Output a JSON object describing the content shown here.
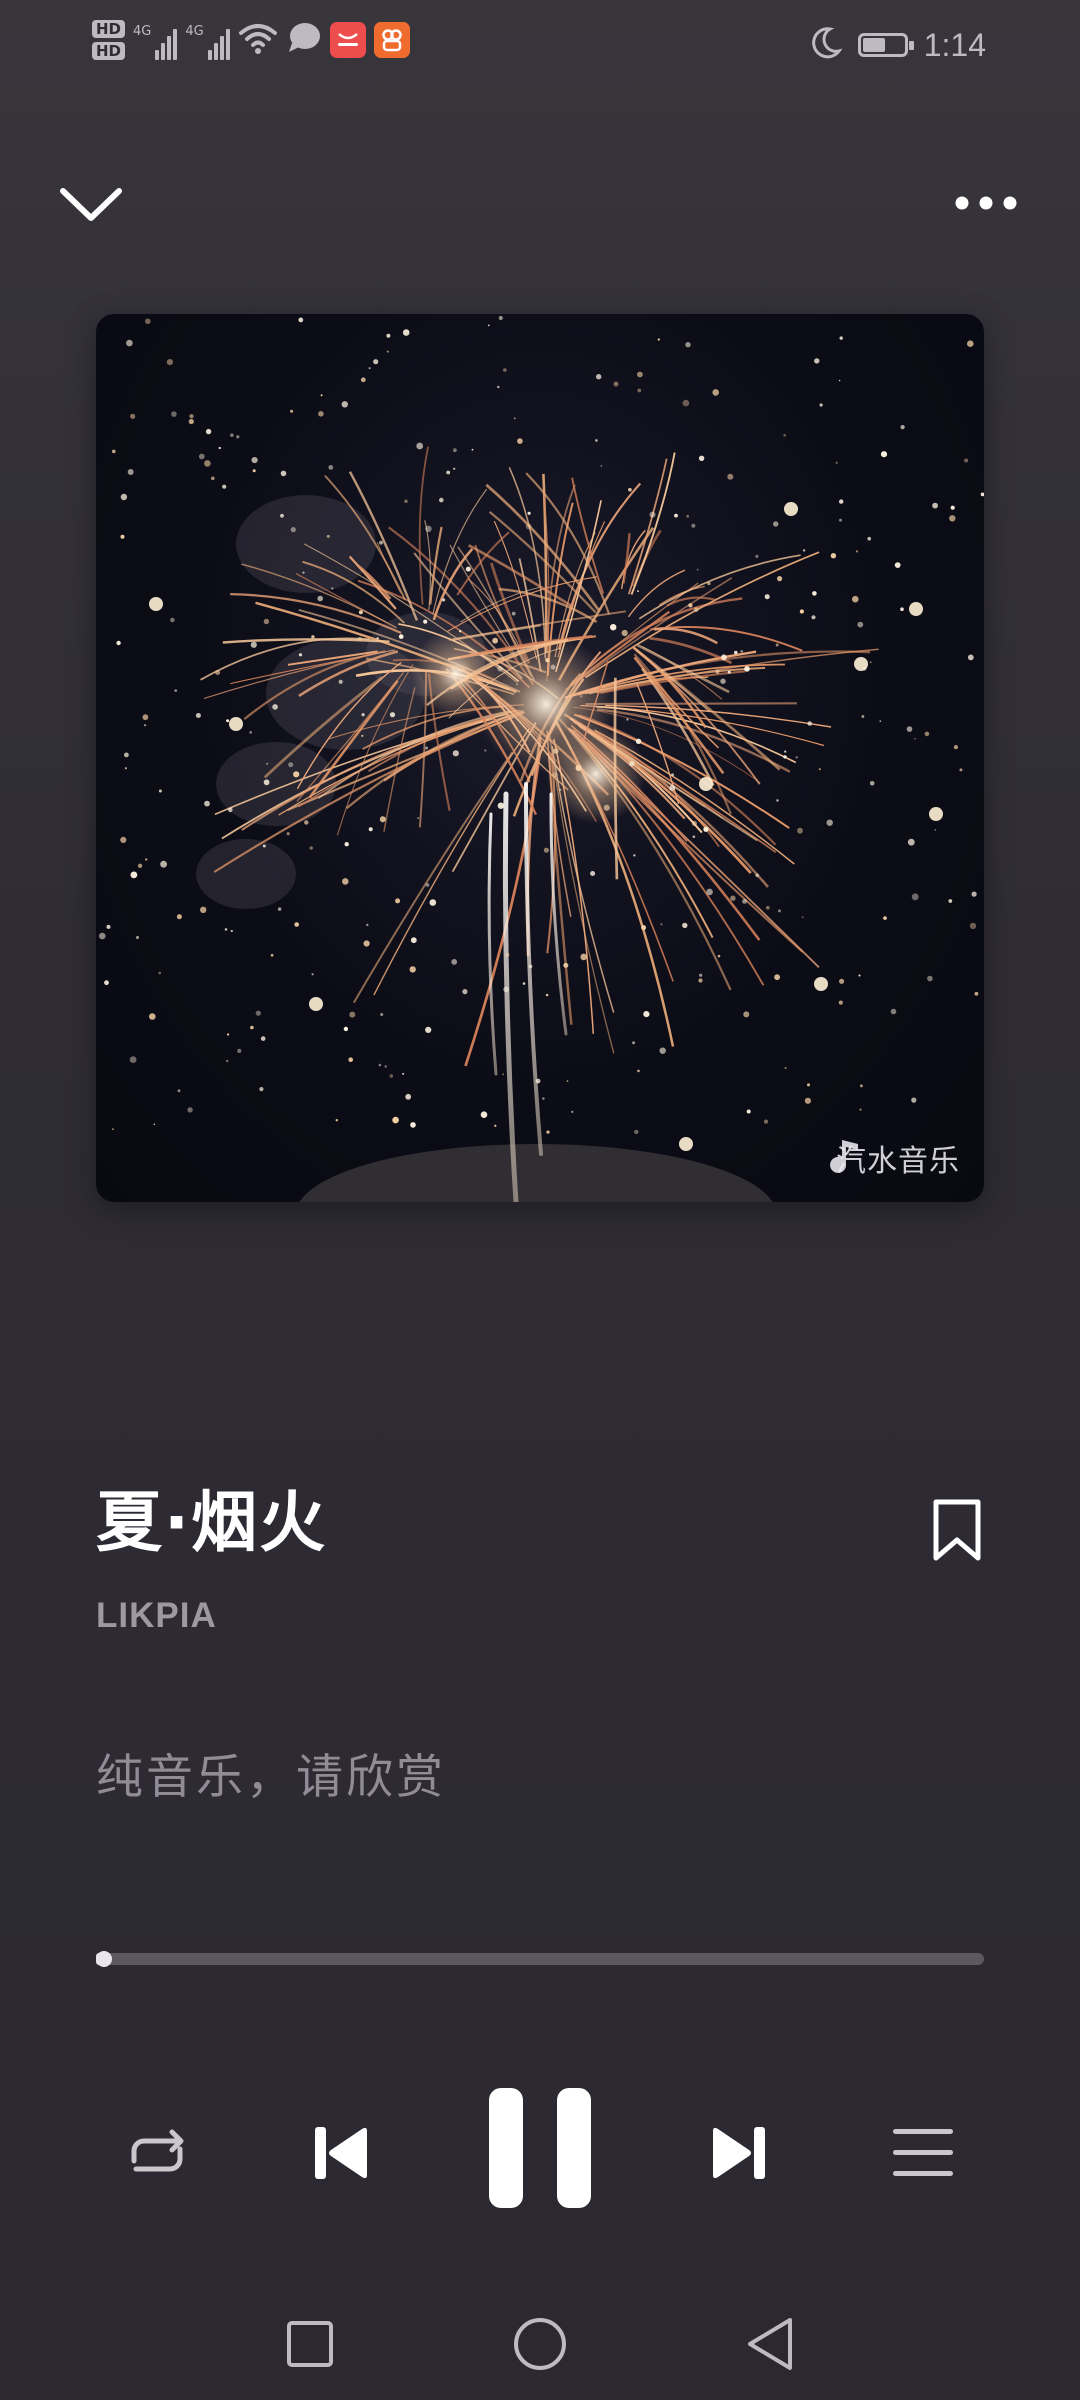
{
  "status_bar": {
    "hd_labels": [
      "HD",
      "HD"
    ],
    "network_labels": [
      "4G",
      "4G"
    ],
    "time": "1:14",
    "icons": [
      "signal-icon",
      "wifi-icon",
      "message-bubble-icon",
      "shopping-app-icon",
      "app-icon",
      "moon-icon",
      "battery-icon"
    ]
  },
  "header": {
    "collapse_icon": "chevron-down-icon",
    "more_icon": "more-dots-icon"
  },
  "artwork": {
    "watermark": "汽水音乐",
    "watermark_icon": "music-note-icon"
  },
  "song": {
    "title": "夏·烟火",
    "artist": "LIKPIA",
    "lyric": "纯音乐，请欣赏"
  },
  "progress": {
    "fraction": 0.0
  },
  "controls": {
    "repeat_icon": "repeat-icon",
    "previous_icon": "skip-previous-icon",
    "pause_icon": "pause-icon",
    "next_icon": "skip-next-icon",
    "playlist_icon": "playlist-icon"
  },
  "colors": {
    "background": "#2c2932",
    "primary_text": "#ffffff",
    "secondary_text": "#9c99a2",
    "lyric_text": "#8f8c96",
    "track": "#5b5862"
  }
}
